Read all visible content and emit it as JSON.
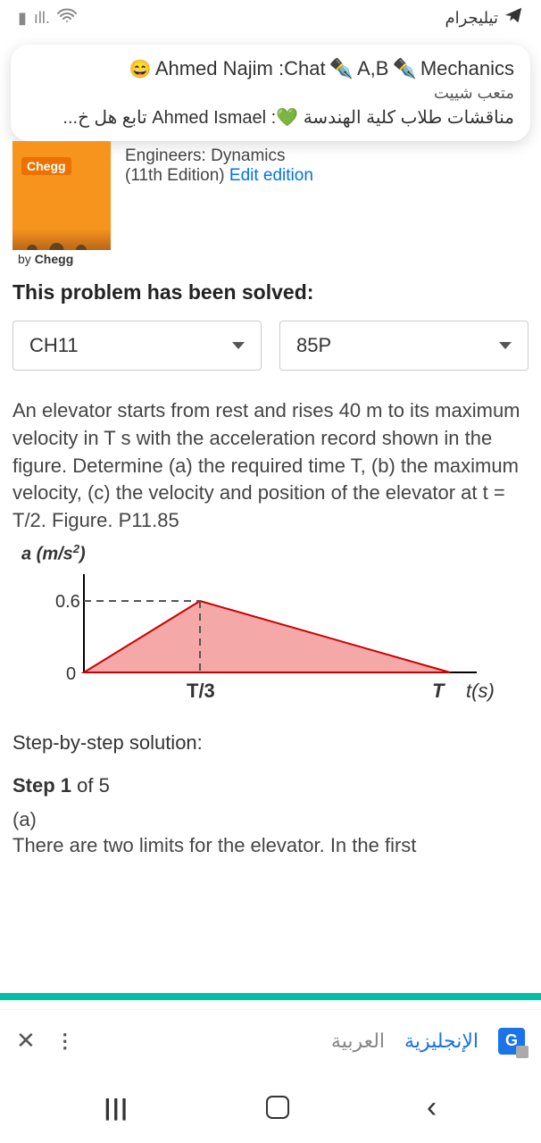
{
  "status": {
    "app_label": "تيليجرام"
  },
  "notification": {
    "line1_left": "Ahmed Najim :Chat",
    "line1_mid": "A,B",
    "line1_right": "Mechanics",
    "line2": "متعب شييت",
    "line3_prefix": "مناقشات طلاب كلية الهندسة",
    "line3_name": "Ahmed Ismael",
    "line3_suffix": "تابع هل خ..."
  },
  "book": {
    "badge": "Chegg",
    "by": "by Chegg",
    "title": "Engineers: Dynamics",
    "edition": "(11th Edition)",
    "edit_link": "Edit edition"
  },
  "solved_heading": "This problem has been solved:",
  "selectors": {
    "chapter": "CH11",
    "problem": "85P"
  },
  "problem_text": "An elevator starts from rest and rises 40 m to its maximum velocity in T s with the acceleration record shown in the figure. Determine (a) the required time T, (b) the maximum velocity, (c) the velocity and position of the elevator at t = T/2. Figure. P11.85",
  "chart_data": {
    "type": "line",
    "title": "",
    "xlabel": "t(s)",
    "ylabel": "a (m/s²)",
    "x_ticks": [
      "0",
      "T/3",
      "T"
    ],
    "y_ticks": [
      "0",
      "0.6"
    ],
    "series": [
      {
        "name": "a",
        "points": [
          [
            0,
            0
          ],
          [
            0.3333,
            0.6
          ],
          [
            1,
            0
          ]
        ]
      }
    ],
    "ylim": [
      0,
      0.7
    ],
    "xlim": [
      0,
      1
    ]
  },
  "solution": {
    "heading": "Step-by-step solution:",
    "step_label": "Step 1",
    "step_of": "of 5",
    "part": "(a)",
    "body": "There are two limits for the elevator. In the first"
  },
  "translate": {
    "lang_ar": "العربية",
    "lang_en": "الإنجليزية",
    "g": "G"
  }
}
